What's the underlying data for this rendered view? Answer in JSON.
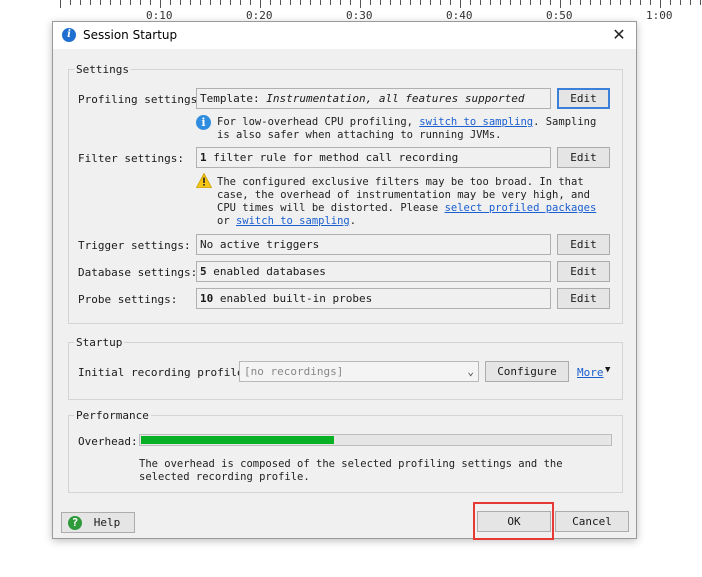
{
  "timeline": {
    "labels": [
      "0:10",
      "0:20",
      "0:30",
      "0:40",
      "0:50",
      "1:00"
    ]
  },
  "dialog": {
    "title": "Session Startup",
    "title_icon": "jprofiler-icon",
    "close_glyph": "✕"
  },
  "settings": {
    "group_title": "Settings",
    "profiling": {
      "label": "Profiling settings:",
      "value_prefix": "Template: ",
      "value_italic": "Instrumentation, all features supported",
      "edit": "Edit",
      "note_prefix": "For low-overhead CPU profiling, ",
      "note_link": "switch to sampling",
      "note_suffix": ". Sampling is also safer when attaching to running JVMs."
    },
    "filter": {
      "label": "Filter settings:",
      "value_bold": "1",
      "value_rest": " filter rule for method call recording",
      "edit": "Edit",
      "warn_prefix": "The configured exclusive filters may be too broad. In that case, the overhead of instrumentation may be very high, and CPU times will be distorted. Please ",
      "warn_link1": "select profiled packages",
      "warn_mid": " or ",
      "warn_link2": "switch to sampling",
      "warn_suffix": "."
    },
    "trigger": {
      "label": "Trigger settings:",
      "value": "No active triggers",
      "edit": "Edit"
    },
    "database": {
      "label": "Database settings:",
      "value_bold": "5",
      "value_rest": " enabled databases",
      "edit": "Edit"
    },
    "probe": {
      "label": "Probe settings:",
      "value_bold": "10",
      "value_rest": " enabled built-in probes",
      "edit": "Edit"
    }
  },
  "startup": {
    "group_title": "Startup",
    "recording_label": "Initial recording profile:",
    "recording_value": "[no recordings]",
    "configure": "Configure",
    "more": "More"
  },
  "performance": {
    "group_title": "Performance",
    "overhead_label": "Overhead:",
    "overhead_fraction": 0.41,
    "overhead_color": "#06b025",
    "note": "The overhead is composed of the selected profiling settings and the selected recording profile."
  },
  "footer": {
    "help": "Help",
    "ok": "OK",
    "cancel": "Cancel",
    "highlight_color": "#e53935"
  }
}
